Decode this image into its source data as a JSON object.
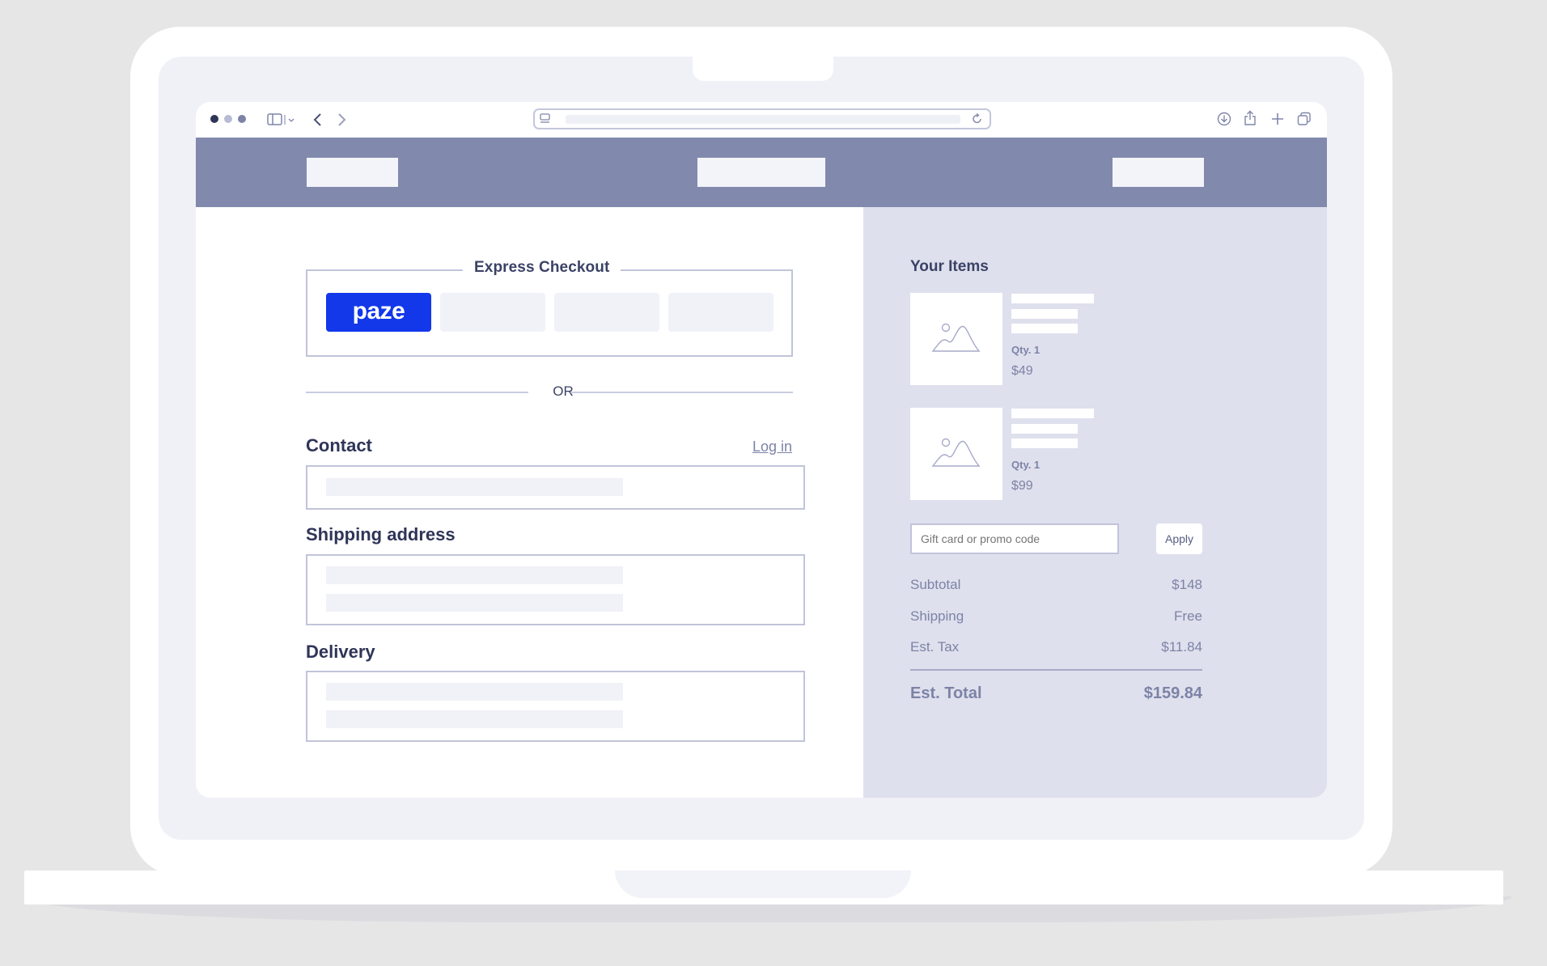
{
  "colors": {
    "page_bg": "#e6e6e7",
    "nav_bar": "#818aad",
    "summary_panel": "#dfe0ed",
    "paze_blue": "#1238ea",
    "text_dark": "#2f3557",
    "text_muted": "#7d83a6"
  },
  "browser": {
    "icons": [
      "sidebar-icon",
      "back-chevron-icon",
      "forward-chevron-icon",
      "reader-icon",
      "reload-icon",
      "download-icon",
      "share-icon",
      "new-tab-icon",
      "tabs-icon"
    ]
  },
  "checkout": {
    "express_title": "Express Checkout",
    "paze_label": "paze",
    "or_label": "OR",
    "contact_title": "Contact",
    "login_label": "Log in",
    "shipping_title": "Shipping address",
    "delivery_title": "Delivery"
  },
  "summary": {
    "title": "Your Items",
    "items": [
      {
        "qty": "Qty. 1",
        "price": "$49"
      },
      {
        "qty": "Qty. 1",
        "price": "$99"
      }
    ],
    "promo_placeholder": "Gift card or promo code",
    "apply_label": "Apply",
    "rows": [
      {
        "label": "Subtotal",
        "value": "$148"
      },
      {
        "label": "Shipping",
        "value": "Free"
      },
      {
        "label": "Est. Tax",
        "value": "$11.84"
      }
    ],
    "total_label": "Est. Total",
    "total_value": "$159.84"
  }
}
